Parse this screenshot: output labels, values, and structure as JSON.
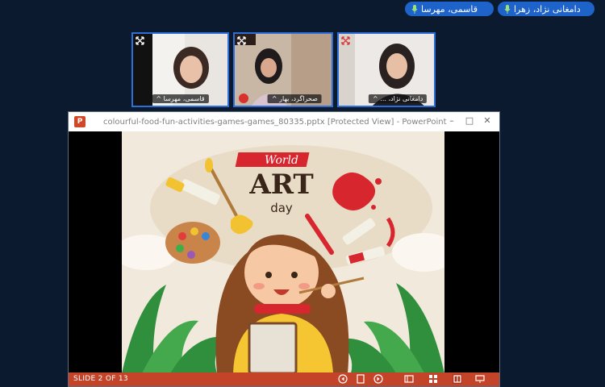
{
  "speakers": [
    {
      "name": "دامغانی نژاد، زهرا"
    },
    {
      "name": "قاسمی، مهرسا"
    }
  ],
  "participants": [
    {
      "name": "قاسمی، مهرسا"
    },
    {
      "name": "صحراگرد، بهار"
    },
    {
      "name": "دامغانی نژاد، ..."
    }
  ],
  "ppt": {
    "logo_letter": "P",
    "title": "colourful-food-fun-activities-games-games_80335.pptx [Protected View] - PowerPoint",
    "slide": {
      "title_word_top": "World",
      "title_word_main": "ART",
      "title_word_bottom": "day"
    },
    "status": {
      "slide_indicator": "SLIDE 2 OF 13"
    }
  },
  "colors": {
    "background": "#0c1a2f",
    "accent_blue": "#1e63c9",
    "ppt_orange": "#c4442a",
    "art_red": "#d8262e"
  },
  "icons": [
    "mic-icon",
    "expand-icon",
    "mic-off-icon",
    "powerpoint-logo-icon",
    "minimize-icon",
    "maximize-icon",
    "close-icon",
    "prev-slide-icon",
    "slide-notes-icon",
    "next-slide-icon",
    "normal-view-icon",
    "slide-sorter-icon",
    "reading-view-icon",
    "slideshow-icon"
  ]
}
